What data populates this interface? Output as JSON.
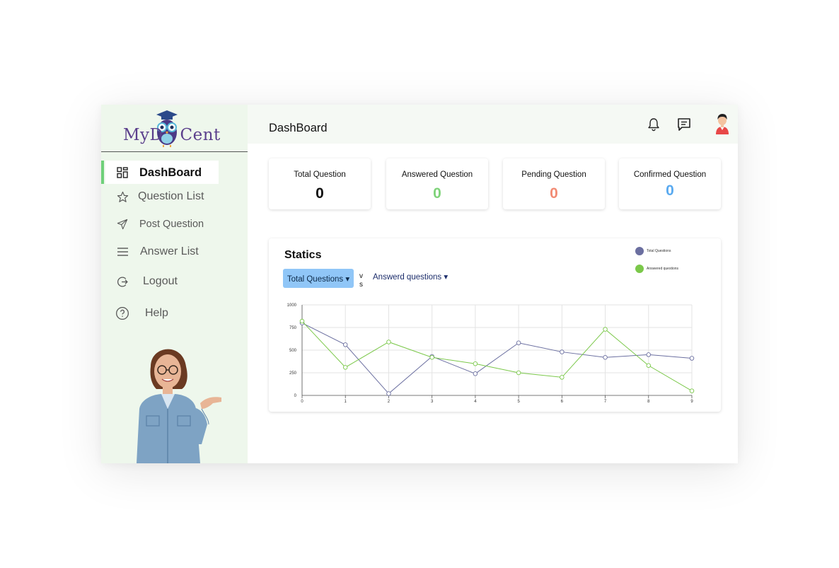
{
  "brand": {
    "logo_text_left": "MyD",
    "logo_text_right": "Cent"
  },
  "sidebar": {
    "items": [
      {
        "label": "DashBoard",
        "icon": "dashboard-grid-icon",
        "active": true
      },
      {
        "label": "Question List",
        "icon": "star-icon",
        "active": false
      },
      {
        "label": "Post Question",
        "icon": "send-icon",
        "active": false
      },
      {
        "label": "Answer List",
        "icon": "menu-lines-icon",
        "active": false
      },
      {
        "label": "Logout",
        "icon": "logout-icon",
        "active": false
      },
      {
        "label": "Help",
        "icon": "help-circle-icon",
        "active": false
      }
    ]
  },
  "header": {
    "title": "DashBoard",
    "icons": [
      "bell-icon",
      "chat-icon",
      "user-avatar-icon"
    ]
  },
  "stats": [
    {
      "label": "Total Question",
      "value": "0",
      "color": "#111111"
    },
    {
      "label": "Answered Question",
      "value": "0",
      "color": "#7fd37a"
    },
    {
      "label": "Pending Question",
      "value": "0",
      "color": "#f28b74"
    },
    {
      "label": "Confirmed Question",
      "value": "0",
      "color": "#5aaaf0"
    }
  ],
  "statics": {
    "title": "Statics",
    "select_a": "Total Questions ▾",
    "vs": "vs",
    "select_b": "Answerd questions ▾",
    "legend": [
      {
        "name": "Total Questions",
        "color": "#6b6fa0"
      },
      {
        "name": "Answered questions",
        "color": "#7bc84a"
      }
    ]
  },
  "chart_data": {
    "type": "line",
    "x": [
      0,
      1,
      2,
      3,
      4,
      5,
      6,
      7,
      8,
      9
    ],
    "ylim": [
      0,
      1000
    ],
    "yticks": [
      0,
      250,
      500,
      750,
      1000
    ],
    "grid": true,
    "legend_position": "top-right",
    "series": [
      {
        "name": "Total Questions",
        "color": "#6b6fa0",
        "values": [
          800,
          560,
          20,
          430,
          240,
          580,
          480,
          420,
          450,
          410
        ]
      },
      {
        "name": "Answered questions",
        "color": "#7bc84a",
        "values": [
          820,
          310,
          590,
          420,
          350,
          250,
          200,
          730,
          330,
          50
        ]
      }
    ]
  }
}
